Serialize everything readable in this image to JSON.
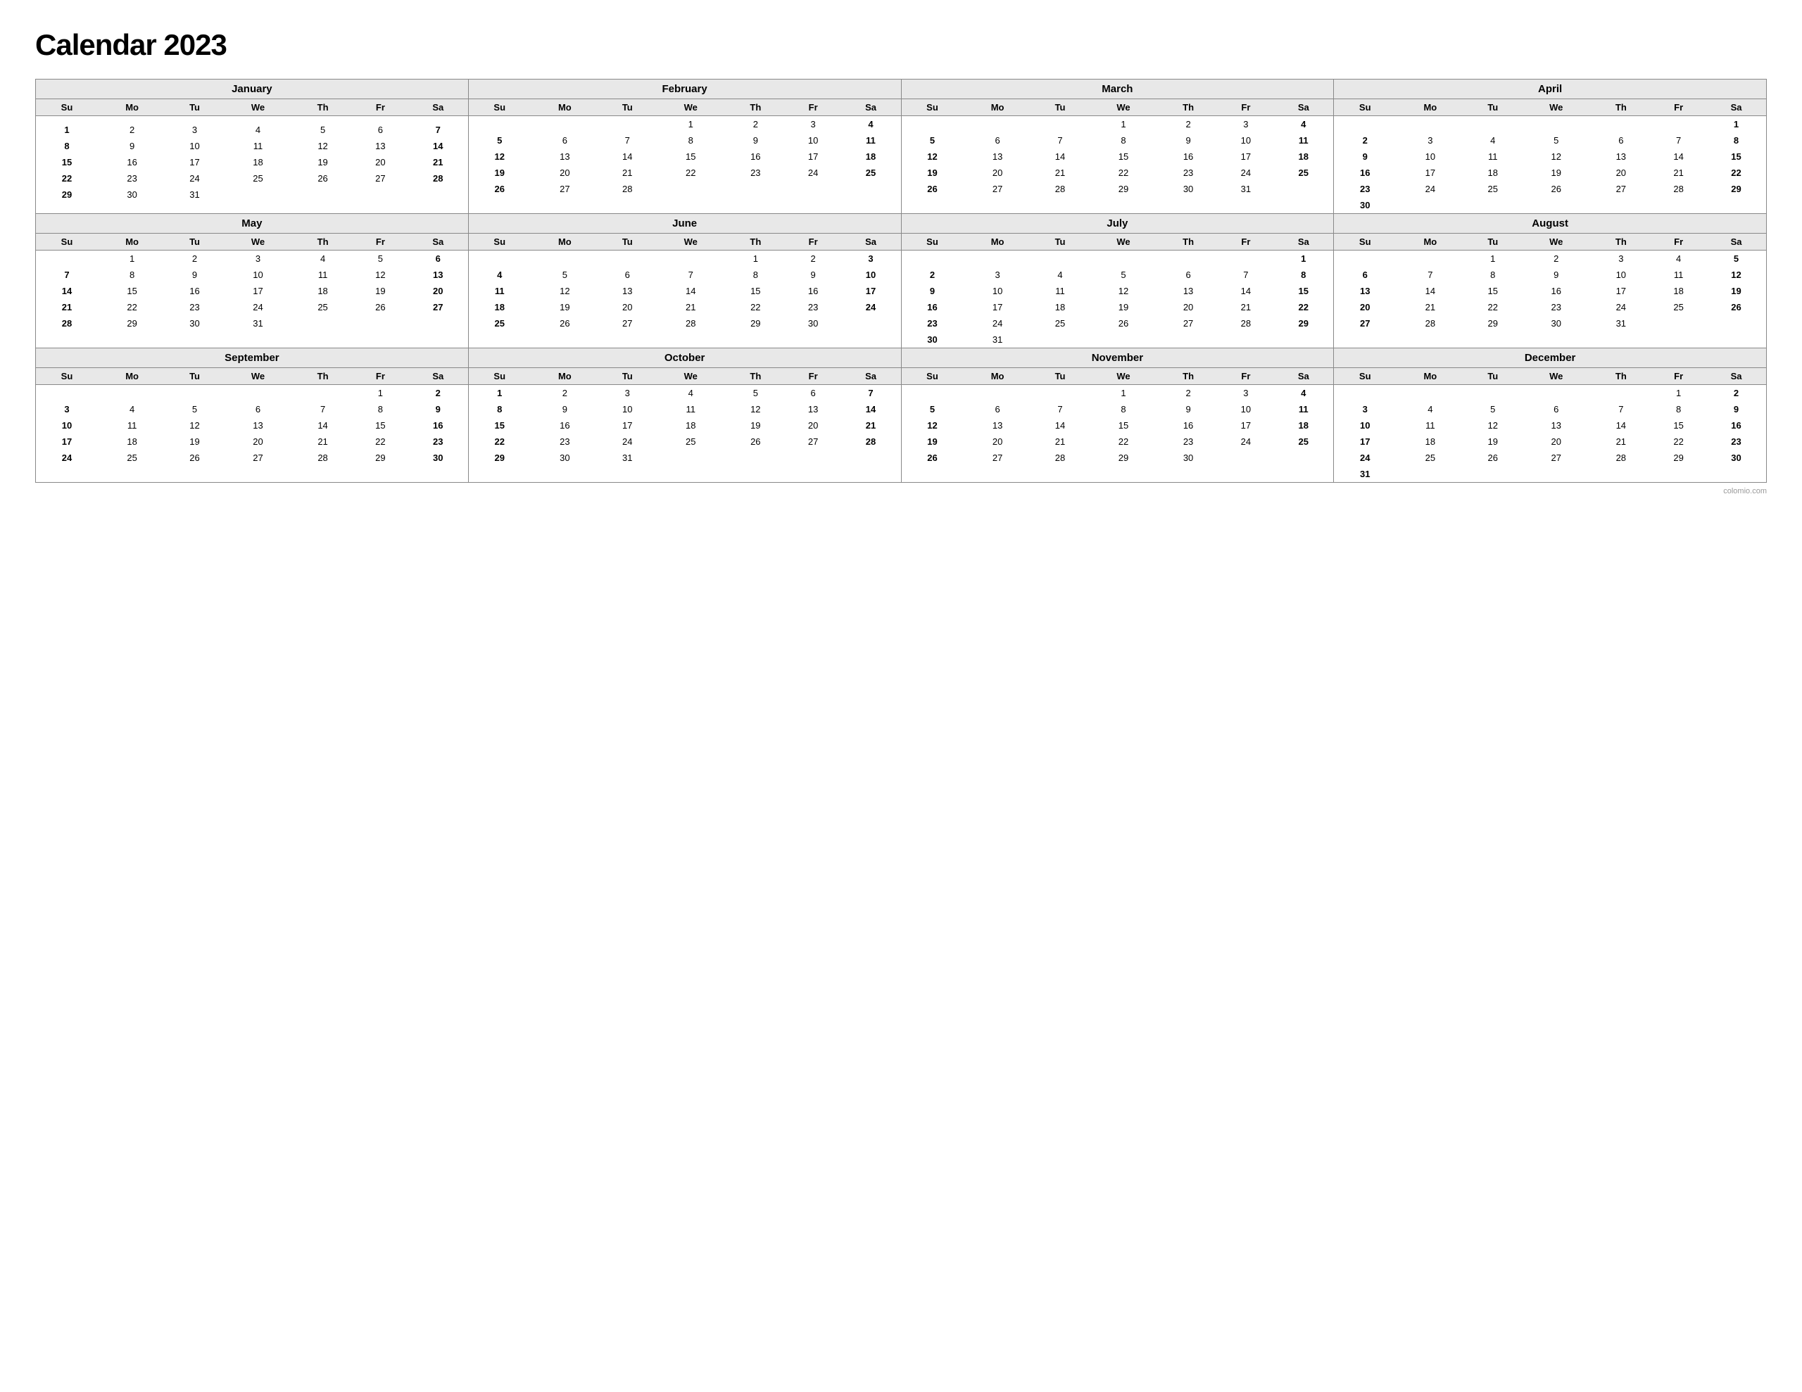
{
  "title": "Calendar 2023",
  "months": [
    {
      "name": "January",
      "days_header": [
        "Su",
        "Mo",
        "Tu",
        "We",
        "Th",
        "Fr",
        "Sa"
      ],
      "weeks": [
        [
          "",
          "",
          "",
          "",
          "",
          "",
          ""
        ],
        [
          "1",
          "2",
          "3",
          "4",
          "5",
          "6",
          "7"
        ],
        [
          "8",
          "9",
          "10",
          "11",
          "12",
          "13",
          "14"
        ],
        [
          "15",
          "16",
          "17",
          "18",
          "19",
          "20",
          "21"
        ],
        [
          "22",
          "23",
          "24",
          "25",
          "26",
          "27",
          "28"
        ],
        [
          "29",
          "30",
          "31",
          "",
          "",
          "",
          ""
        ]
      ],
      "bold_cols": [
        0,
        6
      ]
    },
    {
      "name": "February",
      "days_header": [
        "Su",
        "Mo",
        "Tu",
        "We",
        "Th",
        "Fr",
        "Sa"
      ],
      "weeks": [
        [
          "",
          "",
          "",
          "1",
          "2",
          "3",
          "4"
        ],
        [
          "5",
          "6",
          "7",
          "8",
          "9",
          "10",
          "11"
        ],
        [
          "12",
          "13",
          "14",
          "15",
          "16",
          "17",
          "18"
        ],
        [
          "19",
          "20",
          "21",
          "22",
          "23",
          "24",
          "25"
        ],
        [
          "26",
          "27",
          "28",
          "",
          "",
          "",
          ""
        ]
      ],
      "bold_cols": [
        0,
        6
      ]
    },
    {
      "name": "March",
      "days_header": [
        "Su",
        "Mo",
        "Tu",
        "We",
        "Th",
        "Fr",
        "Sa"
      ],
      "weeks": [
        [
          "",
          "",
          "",
          "1",
          "2",
          "3",
          "4"
        ],
        [
          "5",
          "6",
          "7",
          "8",
          "9",
          "10",
          "11"
        ],
        [
          "12",
          "13",
          "14",
          "15",
          "16",
          "17",
          "18"
        ],
        [
          "19",
          "20",
          "21",
          "22",
          "23",
          "24",
          "25"
        ],
        [
          "26",
          "27",
          "28",
          "29",
          "30",
          "31",
          ""
        ]
      ],
      "bold_cols": [
        0,
        6
      ]
    },
    {
      "name": "April",
      "days_header": [
        "Su",
        "Mo",
        "Tu",
        "We",
        "Th",
        "Fr",
        "Sa"
      ],
      "weeks": [
        [
          "",
          "",
          "",
          "",
          "",
          "",
          "1"
        ],
        [
          "2",
          "3",
          "4",
          "5",
          "6",
          "7",
          "8"
        ],
        [
          "9",
          "10",
          "11",
          "12",
          "13",
          "14",
          "15"
        ],
        [
          "16",
          "17",
          "18",
          "19",
          "20",
          "21",
          "22"
        ],
        [
          "23",
          "24",
          "25",
          "26",
          "27",
          "28",
          "29"
        ],
        [
          "30",
          "",
          "",
          "",
          "",
          "",
          ""
        ]
      ],
      "bold_cols": [
        0,
        6
      ]
    },
    {
      "name": "May",
      "days_header": [
        "Su",
        "Mo",
        "Tu",
        "We",
        "Th",
        "Fr",
        "Sa"
      ],
      "weeks": [
        [
          "",
          "1",
          "2",
          "3",
          "4",
          "5",
          "6"
        ],
        [
          "7",
          "8",
          "9",
          "10",
          "11",
          "12",
          "13"
        ],
        [
          "14",
          "15",
          "16",
          "17",
          "18",
          "19",
          "20"
        ],
        [
          "21",
          "22",
          "23",
          "24",
          "25",
          "26",
          "27"
        ],
        [
          "28",
          "29",
          "30",
          "31",
          "",
          "",
          ""
        ]
      ],
      "bold_cols": [
        0,
        6
      ]
    },
    {
      "name": "June",
      "days_header": [
        "Su",
        "Mo",
        "Tu",
        "We",
        "Th",
        "Fr",
        "Sa"
      ],
      "weeks": [
        [
          "",
          "",
          "",
          "",
          "1",
          "2",
          "3"
        ],
        [
          "4",
          "5",
          "6",
          "7",
          "8",
          "9",
          "10"
        ],
        [
          "11",
          "12",
          "13",
          "14",
          "15",
          "16",
          "17"
        ],
        [
          "18",
          "19",
          "20",
          "21",
          "22",
          "23",
          "24"
        ],
        [
          "25",
          "26",
          "27",
          "28",
          "29",
          "30",
          ""
        ]
      ],
      "bold_cols": [
        0,
        6
      ]
    },
    {
      "name": "July",
      "days_header": [
        "Su",
        "Mo",
        "Tu",
        "We",
        "Th",
        "Fr",
        "Sa"
      ],
      "weeks": [
        [
          "",
          "",
          "",
          "",
          "",
          "",
          "1"
        ],
        [
          "2",
          "3",
          "4",
          "5",
          "6",
          "7",
          "8"
        ],
        [
          "9",
          "10",
          "11",
          "12",
          "13",
          "14",
          "15"
        ],
        [
          "16",
          "17",
          "18",
          "19",
          "20",
          "21",
          "22"
        ],
        [
          "23",
          "24",
          "25",
          "26",
          "27",
          "28",
          "29"
        ],
        [
          "30",
          "31",
          "",
          "",
          "",
          "",
          ""
        ]
      ],
      "bold_cols": [
        0,
        6
      ]
    },
    {
      "name": "August",
      "days_header": [
        "Su",
        "Mo",
        "Tu",
        "We",
        "Th",
        "Fr",
        "Sa"
      ],
      "weeks": [
        [
          "",
          "",
          "1",
          "2",
          "3",
          "4",
          "5"
        ],
        [
          "6",
          "7",
          "8",
          "9",
          "10",
          "11",
          "12"
        ],
        [
          "13",
          "14",
          "15",
          "16",
          "17",
          "18",
          "19"
        ],
        [
          "20",
          "21",
          "22",
          "23",
          "24",
          "25",
          "26"
        ],
        [
          "27",
          "28",
          "29",
          "30",
          "31",
          "",
          ""
        ]
      ],
      "bold_cols": [
        0,
        6
      ]
    },
    {
      "name": "September",
      "days_header": [
        "Su",
        "Mo",
        "Tu",
        "We",
        "Th",
        "Fr",
        "Sa"
      ],
      "weeks": [
        [
          "",
          "",
          "",
          "",
          "",
          "1",
          "2"
        ],
        [
          "3",
          "4",
          "5",
          "6",
          "7",
          "8",
          "9"
        ],
        [
          "10",
          "11",
          "12",
          "13",
          "14",
          "15",
          "16"
        ],
        [
          "17",
          "18",
          "19",
          "20",
          "21",
          "22",
          "23"
        ],
        [
          "24",
          "25",
          "26",
          "27",
          "28",
          "29",
          "30"
        ]
      ],
      "bold_cols": [
        0,
        6
      ]
    },
    {
      "name": "October",
      "days_header": [
        "Su",
        "Mo",
        "Tu",
        "We",
        "Th",
        "Fr",
        "Sa"
      ],
      "weeks": [
        [
          "1",
          "2",
          "3",
          "4",
          "5",
          "6",
          "7"
        ],
        [
          "8",
          "9",
          "10",
          "11",
          "12",
          "13",
          "14"
        ],
        [
          "15",
          "16",
          "17",
          "18",
          "19",
          "20",
          "21"
        ],
        [
          "22",
          "23",
          "24",
          "25",
          "26",
          "27",
          "28"
        ],
        [
          "29",
          "30",
          "31",
          "",
          "",
          "",
          ""
        ]
      ],
      "bold_cols": [
        0,
        6
      ]
    },
    {
      "name": "November",
      "days_header": [
        "Su",
        "Mo",
        "Tu",
        "We",
        "Th",
        "Fr",
        "Sa"
      ],
      "weeks": [
        [
          "",
          "",
          "",
          "1",
          "2",
          "3",
          "4"
        ],
        [
          "5",
          "6",
          "7",
          "8",
          "9",
          "10",
          "11"
        ],
        [
          "12",
          "13",
          "14",
          "15",
          "16",
          "17",
          "18"
        ],
        [
          "19",
          "20",
          "21",
          "22",
          "23",
          "24",
          "25"
        ],
        [
          "26",
          "27",
          "28",
          "29",
          "30",
          "",
          ""
        ]
      ],
      "bold_cols": [
        0,
        6
      ]
    },
    {
      "name": "December",
      "days_header": [
        "Su",
        "Mo",
        "Tu",
        "We",
        "Th",
        "Fr",
        "Sa"
      ],
      "weeks": [
        [
          "",
          "",
          "",
          "",
          "",
          "1",
          "2"
        ],
        [
          "3",
          "4",
          "5",
          "6",
          "7",
          "8",
          "9"
        ],
        [
          "10",
          "11",
          "12",
          "13",
          "14",
          "15",
          "16"
        ],
        [
          "17",
          "18",
          "19",
          "20",
          "21",
          "22",
          "23"
        ],
        [
          "24",
          "25",
          "26",
          "27",
          "28",
          "29",
          "30"
        ],
        [
          "31",
          "",
          "",
          "",
          "",
          "",
          ""
        ]
      ],
      "bold_cols": [
        0,
        6
      ]
    }
  ],
  "watermark": "colomio.com"
}
